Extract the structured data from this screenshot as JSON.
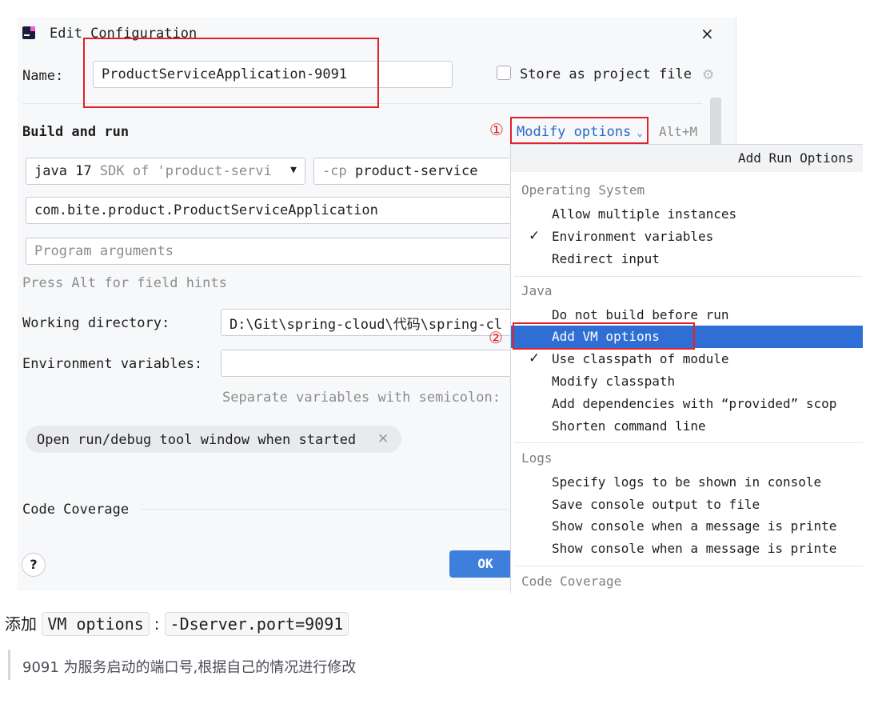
{
  "dialog": {
    "title": "Edit Configuration",
    "close_glyph": "×",
    "name_label": "Name:",
    "name_value": "ProductServiceApplication-9091",
    "store_as_project_file": "Store as project file",
    "build_and_run": "Build and run",
    "modify_options": "Modify options",
    "modify_options_shortcut": "Alt+M",
    "marker_1": "①",
    "marker_2": "②",
    "sdk_bold": "java 17",
    "sdk_rest": "SDK of 'product-servi",
    "cp_prefix": "-cp",
    "cp_value": "product-service",
    "main_class": "com.bite.product.ProductServiceApplication",
    "program_args_placeholder": "Program arguments",
    "field_hints": "Press Alt for field hints",
    "working_dir_label": "Working directory:",
    "working_dir_value": "D:\\Git\\spring-cloud\\代码\\spring-cl",
    "env_vars_label": "Environment variables:",
    "env_vars_value": "",
    "env_vars_hint": "Separate variables with semicolon:",
    "tag_open_tool_window": "Open run/debug tool window when started",
    "tag_close_glyph": "×",
    "code_coverage": "Code Coverage",
    "help": "?",
    "ok": "OK"
  },
  "popup": {
    "header": "Add Run Options",
    "sections": [
      {
        "title": "Operating System",
        "items": [
          {
            "label": "Allow multiple instances",
            "checked": false
          },
          {
            "label": "Environment variables",
            "checked": true
          },
          {
            "label": "Redirect input",
            "checked": false
          }
        ]
      },
      {
        "title": "Java",
        "items": [
          {
            "label": "Do not build before run",
            "checked": false
          },
          {
            "label": "Add VM options",
            "checked": false,
            "selected": true
          },
          {
            "label": "Use classpath of module",
            "checked": true
          },
          {
            "label": "Modify classpath",
            "checked": false
          },
          {
            "label": "Add dependencies with “provided” scop",
            "checked": false
          },
          {
            "label": "Shorten command line",
            "checked": false
          }
        ]
      },
      {
        "title": "Logs",
        "items": [
          {
            "label": "Specify logs to be shown in console",
            "checked": false
          },
          {
            "label": "Save console output to file",
            "checked": false
          },
          {
            "label": "Show console when a message is printe",
            "checked": false
          },
          {
            "label": "Show console when a message is printe",
            "checked": false
          }
        ]
      },
      {
        "title": "Code Coverage",
        "items": []
      }
    ],
    "check_glyph": "✓"
  },
  "caption": {
    "prefix": "添加",
    "code1": "VM options",
    "separator": ":",
    "code2": "-Dserver.port=9091",
    "note": "9091 为服务启动的端口号,根据自己的情况进行修改"
  },
  "colors": {
    "accent": "#2f6fd5",
    "annotation_red": "#e0202a",
    "link_blue": "#2a67c4"
  }
}
